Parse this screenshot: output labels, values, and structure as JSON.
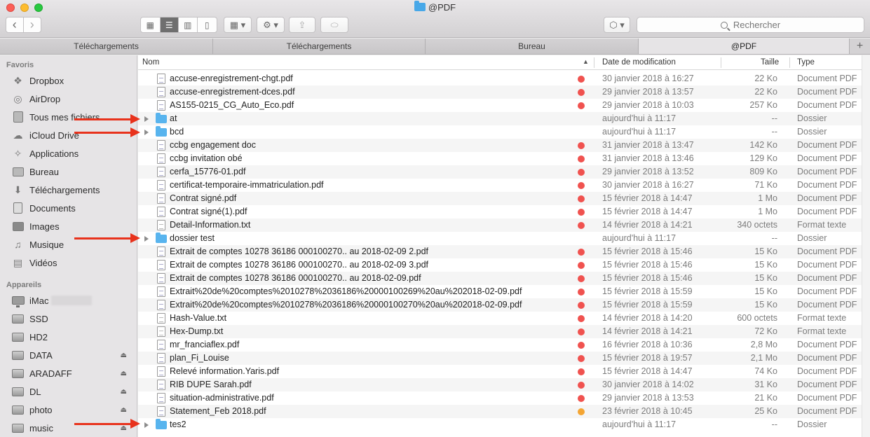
{
  "window": {
    "title": "@PDF"
  },
  "toolbar": {
    "back": "‹",
    "forward": "›",
    "view_icon": "▦",
    "view_list": "☰",
    "view_columns": "▥",
    "view_coverflow": "▯",
    "arrange": "▦ ▾",
    "action": "⚙ ▾",
    "share": "⇪",
    "tag": "⬭",
    "dropbox": "⬡ ▾",
    "search_placeholder": "Rechercher"
  },
  "tabs": [
    {
      "label": "Téléchargements"
    },
    {
      "label": "Téléchargements"
    },
    {
      "label": "Bureau"
    },
    {
      "label": "@PDF"
    }
  ],
  "sidebar": {
    "favorites_title": "Favoris",
    "favorites": [
      {
        "label": "Dropbox",
        "icon": "dropbox-icon"
      },
      {
        "label": "AirDrop",
        "icon": "airdrop-icon"
      },
      {
        "label": "Tous mes fichiers",
        "icon": "all-files-icon"
      },
      {
        "label": "iCloud Drive",
        "icon": "cloud-icon"
      },
      {
        "label": "Applications",
        "icon": "applications-icon"
      },
      {
        "label": "Bureau",
        "icon": "desktop-icon"
      },
      {
        "label": "Téléchargements",
        "icon": "download-icon"
      },
      {
        "label": "Documents",
        "icon": "documents-icon"
      },
      {
        "label": "Images",
        "icon": "camera-icon"
      },
      {
        "label": "Musique",
        "icon": "music-icon"
      },
      {
        "label": "Vidéos",
        "icon": "film-icon"
      }
    ],
    "devices_title": "Appareils",
    "devices": [
      {
        "label": "iMac",
        "icon": "imac-icon",
        "eject": false
      },
      {
        "label": "SSD",
        "icon": "disk-icon",
        "eject": false
      },
      {
        "label": "HD2",
        "icon": "disk-icon",
        "eject": false
      },
      {
        "label": "DATA",
        "icon": "disk-icon",
        "eject": true
      },
      {
        "label": "ARADAFF",
        "icon": "disk-icon",
        "eject": true
      },
      {
        "label": "DL",
        "icon": "disk-icon",
        "eject": true
      },
      {
        "label": "photo",
        "icon": "disk-icon",
        "eject": true
      },
      {
        "label": "music",
        "icon": "disk-icon",
        "eject": true
      }
    ]
  },
  "columns": {
    "name": "Nom",
    "date": "Date de modification",
    "size": "Taille",
    "type": "Type"
  },
  "colors": {
    "tag_red": "#f0524f",
    "tag_orange": "#f4a533",
    "arrow": "#e8321c",
    "folder": "#58b4ee"
  },
  "files": [
    {
      "name": "accuse-enregistrement-chgt.pdf",
      "kind": "pdf",
      "tag": "red",
      "date": "30 janvier 2018 à 16:27",
      "size": "22 Ko",
      "type": "Document PDF"
    },
    {
      "name": "accuse-enregistrement-dces.pdf",
      "kind": "pdf",
      "tag": "red",
      "date": "29 janvier 2018 à 13:57",
      "size": "22 Ko",
      "type": "Document PDF"
    },
    {
      "name": "AS155-0215_CG_Auto_Eco.pdf",
      "kind": "pdf",
      "tag": "red",
      "date": "29 janvier 2018 à 10:03",
      "size": "257 Ko",
      "type": "Document PDF"
    },
    {
      "name": "at",
      "kind": "folder",
      "tag": "",
      "date": "aujourd'hui à 11:17",
      "size": "--",
      "type": "Dossier"
    },
    {
      "name": "bcd",
      "kind": "folder",
      "tag": "",
      "date": "aujourd'hui à 11:17",
      "size": "--",
      "type": "Dossier"
    },
    {
      "name": "ccbg engagement doc",
      "kind": "pdf",
      "tag": "red",
      "date": "31 janvier 2018 à 13:47",
      "size": "142 Ko",
      "type": "Document PDF"
    },
    {
      "name": "ccbg invitation obé",
      "kind": "pdf",
      "tag": "red",
      "date": "31 janvier 2018 à 13:46",
      "size": "129 Ko",
      "type": "Document PDF"
    },
    {
      "name": "cerfa_15776-01.pdf",
      "kind": "pdf",
      "tag": "red",
      "date": "29 janvier 2018 à 13:52",
      "size": "809 Ko",
      "type": "Document PDF"
    },
    {
      "name": "certificat-temporaire-immatriculation.pdf",
      "kind": "pdf",
      "tag": "red",
      "date": "30 janvier 2018 à 16:27",
      "size": "71 Ko",
      "type": "Document PDF"
    },
    {
      "name": "Contrat signé.pdf",
      "kind": "pdf",
      "tag": "red",
      "date": "15 février 2018 à 14:47",
      "size": "1 Mo",
      "type": "Document PDF"
    },
    {
      "name": "Contrat signé(1).pdf",
      "kind": "pdf",
      "tag": "red",
      "date": "15 février 2018 à 14:47",
      "size": "1 Mo",
      "type": "Document PDF"
    },
    {
      "name": "Detail-Information.txt",
      "kind": "txt",
      "tag": "red",
      "date": "14 février 2018 à 14:21",
      "size": "340 octets",
      "type": "Format texte"
    },
    {
      "name": "dossier test",
      "kind": "folder",
      "tag": "",
      "date": "aujourd'hui à 11:17",
      "size": "--",
      "type": "Dossier"
    },
    {
      "name": "Extrait de comptes 10278 36186 000100270.. au 2018-02-09 2.pdf",
      "kind": "pdf",
      "tag": "red",
      "date": "15 février 2018 à 15:46",
      "size": "15 Ko",
      "type": "Document PDF"
    },
    {
      "name": "Extrait de comptes 10278 36186 000100270.. au 2018-02-09 3.pdf",
      "kind": "pdf",
      "tag": "red",
      "date": "15 février 2018 à 15:46",
      "size": "15 Ko",
      "type": "Document PDF"
    },
    {
      "name": "Extrait de comptes 10278 36186 000100270.. au 2018-02-09.pdf",
      "kind": "pdf",
      "tag": "red",
      "date": "15 février 2018 à 15:46",
      "size": "15 Ko",
      "type": "Document PDF"
    },
    {
      "name": "Extrait%20de%20comptes%2010278%2036186%20000100269%20au%202018-02-09.pdf",
      "kind": "pdf",
      "tag": "red",
      "date": "15 février 2018 à 15:59",
      "size": "15 Ko",
      "type": "Document PDF"
    },
    {
      "name": "Extrait%20de%20comptes%2010278%2036186%20000100270%20au%202018-02-09.pdf",
      "kind": "pdf",
      "tag": "red",
      "date": "15 février 2018 à 15:59",
      "size": "15 Ko",
      "type": "Document PDF"
    },
    {
      "name": "Hash-Value.txt",
      "kind": "txt",
      "tag": "red",
      "date": "14 février 2018 à 14:20",
      "size": "600 octets",
      "type": "Format texte"
    },
    {
      "name": "Hex-Dump.txt",
      "kind": "txt",
      "tag": "red",
      "date": "14 février 2018 à 14:21",
      "size": "72 Ko",
      "type": "Format texte"
    },
    {
      "name": "mr_franciaflex.pdf",
      "kind": "pdf",
      "tag": "red",
      "date": "16 février 2018 à 10:36",
      "size": "2,8 Mo",
      "type": "Document PDF"
    },
    {
      "name": "plan_Fi_Louise",
      "kind": "pdf",
      "tag": "red",
      "date": "15 février 2018 à 19:57",
      "size": "2,1 Mo",
      "type": "Document PDF"
    },
    {
      "name": "Relevé information.Yaris.pdf",
      "kind": "pdf",
      "tag": "red",
      "date": "15 février 2018 à 14:47",
      "size": "74 Ko",
      "type": "Document PDF"
    },
    {
      "name": "RIB DUPE Sarah.pdf",
      "kind": "pdf",
      "tag": "red",
      "date": "30 janvier 2018 à 14:02",
      "size": "31 Ko",
      "type": "Document PDF"
    },
    {
      "name": "situation-administrative.pdf",
      "kind": "pdf",
      "tag": "red",
      "date": "29 janvier 2018 à 13:53",
      "size": "21 Ko",
      "type": "Document PDF"
    },
    {
      "name": "Statement_Feb 2018.pdf",
      "kind": "pdf",
      "tag": "orange",
      "date": "23 février 2018 à 10:45",
      "size": "25 Ko",
      "type": "Document PDF"
    },
    {
      "name": "tes2",
      "kind": "folder",
      "tag": "",
      "date": "aujourd'hui à 11:17",
      "size": "--",
      "type": "Dossier"
    }
  ]
}
